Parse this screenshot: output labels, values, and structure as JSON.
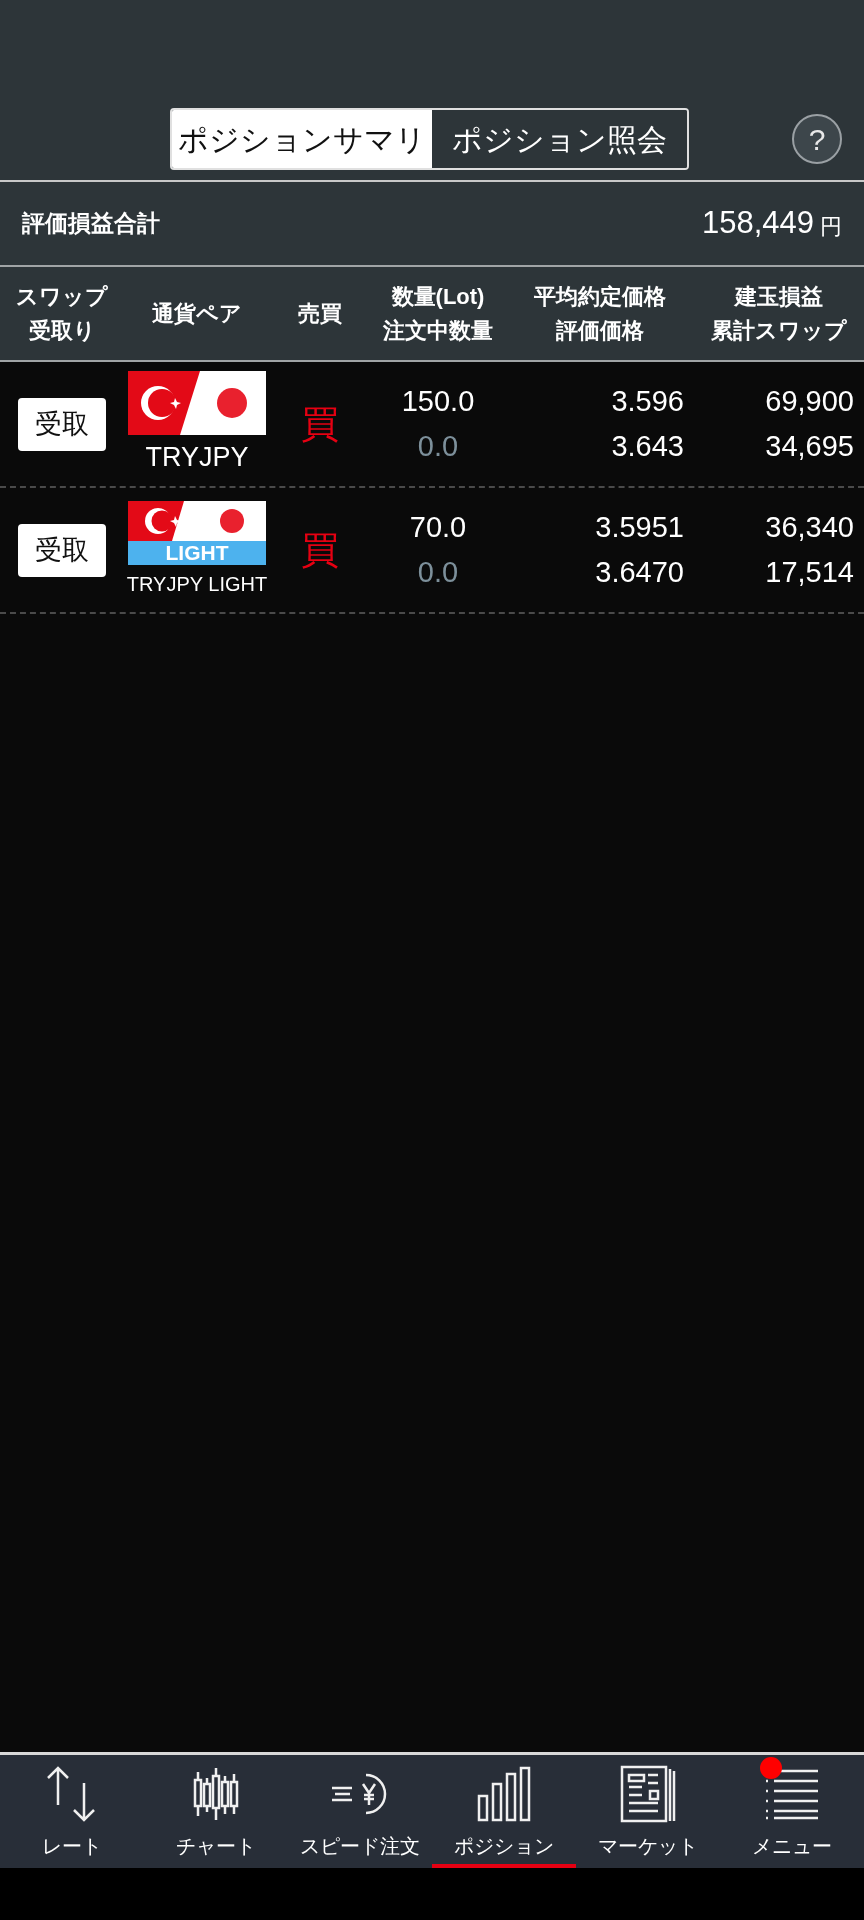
{
  "tabs": [
    {
      "label": "ポジションサマリ",
      "selected": true
    },
    {
      "label": "ポジション照会",
      "selected": false
    }
  ],
  "help": "?",
  "summary": {
    "label": "評価損益合計",
    "value": "158,449",
    "unit": "円"
  },
  "table": {
    "columns": [
      {
        "lines": [
          "スワップ",
          "受取り"
        ]
      },
      {
        "lines": [
          "通貨ペア"
        ]
      },
      {
        "lines": [
          "売買"
        ]
      },
      {
        "lines": [
          "数量(Lot)",
          "注文中数量"
        ]
      },
      {
        "lines": [
          "平均約定価格",
          "評価価格"
        ]
      },
      {
        "lines": [
          "建玉損益",
          "累計スワップ"
        ]
      }
    ],
    "rows": [
      {
        "swap_button": "受取",
        "pair": "TRYJPY",
        "side": "買",
        "quantity": "150.0",
        "order_quantity": "0.0",
        "avg_price": "3.596",
        "eval_price": "3.643",
        "pl": "69,900",
        "swap": "34,695"
      },
      {
        "swap_button": "受取",
        "pair": "TRYJPY LIGHT",
        "flag_badge": "LIGHT",
        "side": "買",
        "quantity": "70.0",
        "order_quantity": "0.0",
        "avg_price": "3.5951",
        "eval_price": "3.6470",
        "pl": "36,340",
        "swap": "17,514"
      }
    ]
  },
  "nav": [
    {
      "label": "レート",
      "kind": "rate",
      "selected": false,
      "notification": false
    },
    {
      "label": "チャート",
      "kind": "chart",
      "selected": false,
      "notification": false
    },
    {
      "label": "スピード注文",
      "kind": "speed",
      "selected": false,
      "notification": false
    },
    {
      "label": "ポジション",
      "kind": "position",
      "selected": true,
      "notification": false
    },
    {
      "label": "マーケット",
      "kind": "market",
      "selected": false,
      "notification": false
    },
    {
      "label": "メニュー",
      "kind": "menu",
      "selected": false,
      "notification": true
    }
  ]
}
